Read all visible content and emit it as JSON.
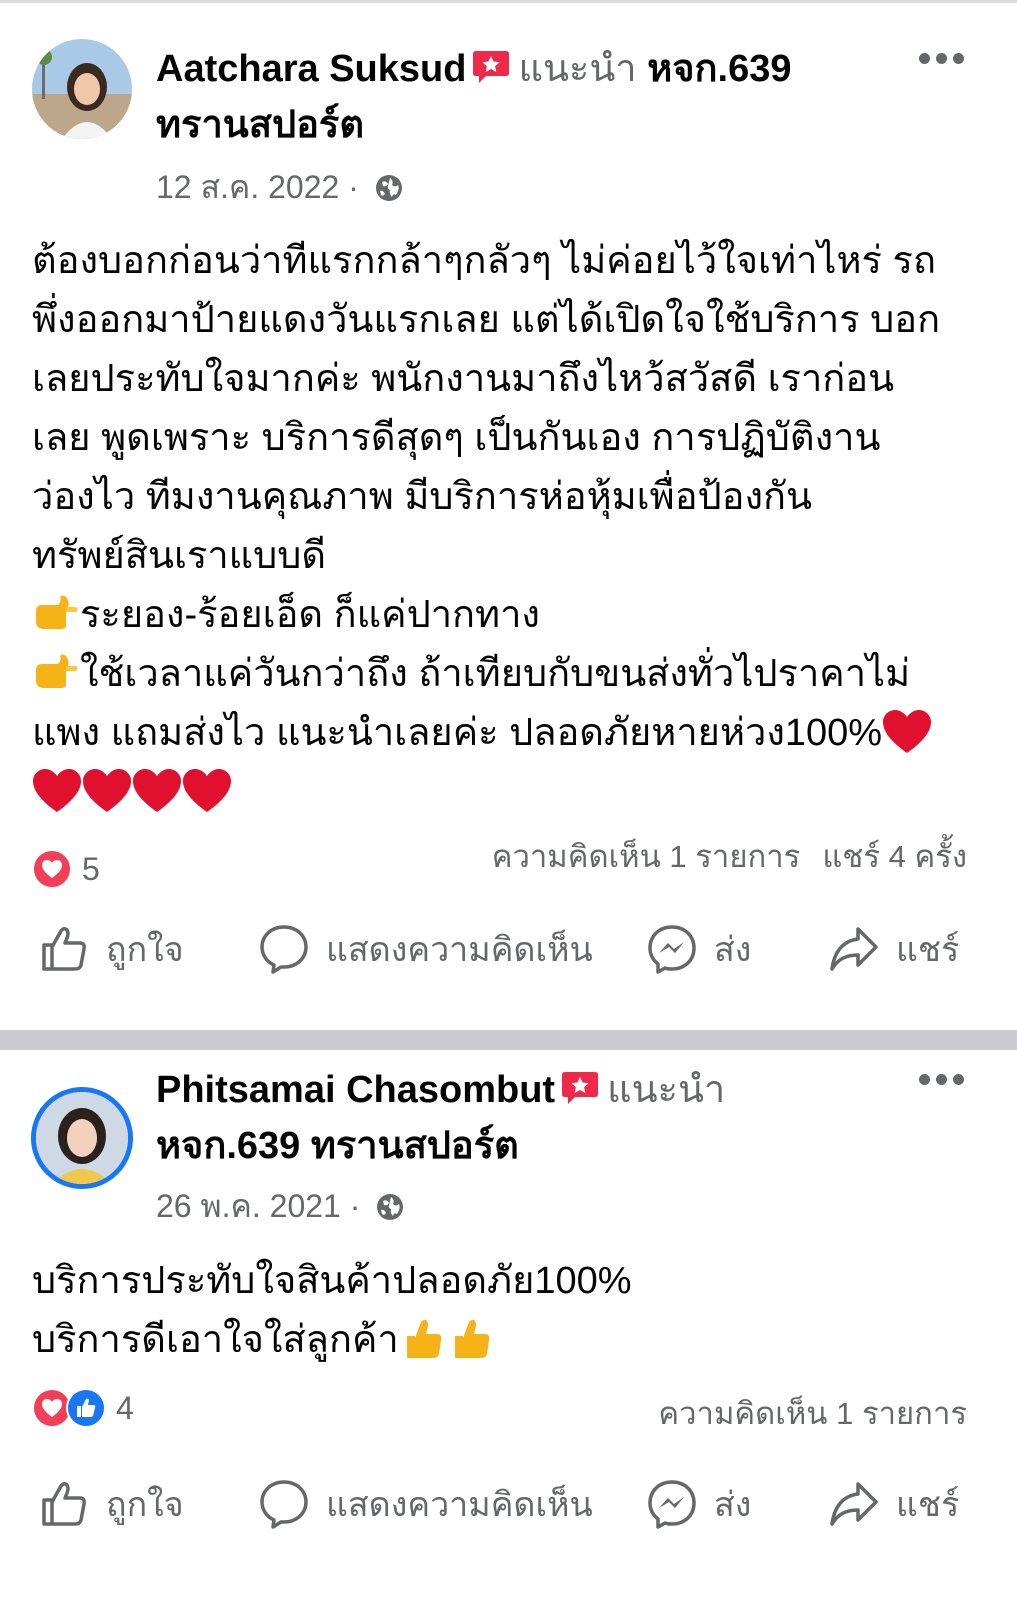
{
  "posts": [
    {
      "author": "Aatchara Suksud",
      "recommends": "แนะนำ",
      "page": "หจก.639 ทรานสปอร์ต",
      "date": "12 ส.ค. 2022",
      "body_lines": [
        "ต้องบอกก่อนว่าทีแรกกล้าๆกลัวๆ ไม่ค่อยไว้ใจเท่าไหร่ รถ",
        "พึ่งออกมาป้ายแดงวันแรกเลย แต่ได้เปิดใจใช้บริการ บอก",
        "เลยประทับใจมากค่ะ พนักงานมาถึงไหว้สวัสดี เราก่อน",
        "เลย พูดเพราะ บริการดีสุดๆ เป็นกันเอง การปฏิบัติงาน",
        "ว่องไว ทีมงานคุณภาพ มีบริการห่อหุ้มเพื่อป้องกัน",
        "ทรัพย์สินเราแบบดี",
        "ระยอง-ร้อยเอ็ด ก็แค่ปากทาง",
        "ใช้เวลาแค่วันกว่าถึง ถ้าเทียบกับขนส่งทั่วไปราคาไม่",
        "แพง แถมส่งไว แนะนำเลยค่ะ ปลอดภัยหายห่วง100%"
      ],
      "reaction_count": "5",
      "comments": "ความคิดเห็น 1 รายการ",
      "shares": "แชร์ 4 ครั้ง"
    },
    {
      "author": "Phitsamai Chasombut",
      "recommends": "แนะนำ",
      "page": "หจก.639 ทรานสปอร์ต",
      "date": "26 พ.ค. 2021",
      "body_lines": [
        "บริการประทับใจสินค้าปลอดภัย100%",
        "บริการดีเอาใจใส่ลูกค้า"
      ],
      "reaction_count": "4",
      "comments": "ความคิดเห็น 1 รายการ"
    }
  ],
  "actions": {
    "like": "ถูกใจ",
    "comment": "แสดงความคิดเห็น",
    "send": "ส่ง",
    "share": "แชร์"
  },
  "icons": [
    "more-icon",
    "recommend-badge-icon",
    "globe-icon",
    "point-right-emoji",
    "heart-emoji",
    "thumbs-up-emoji",
    "love-reaction-icon",
    "like-reaction-icon",
    "like-icon",
    "comment-icon",
    "messenger-icon",
    "share-icon"
  ],
  "colors": {
    "accent": "#1877f2",
    "love": "#f33e58",
    "muted": "#65676b",
    "badge": "#f02849"
  }
}
